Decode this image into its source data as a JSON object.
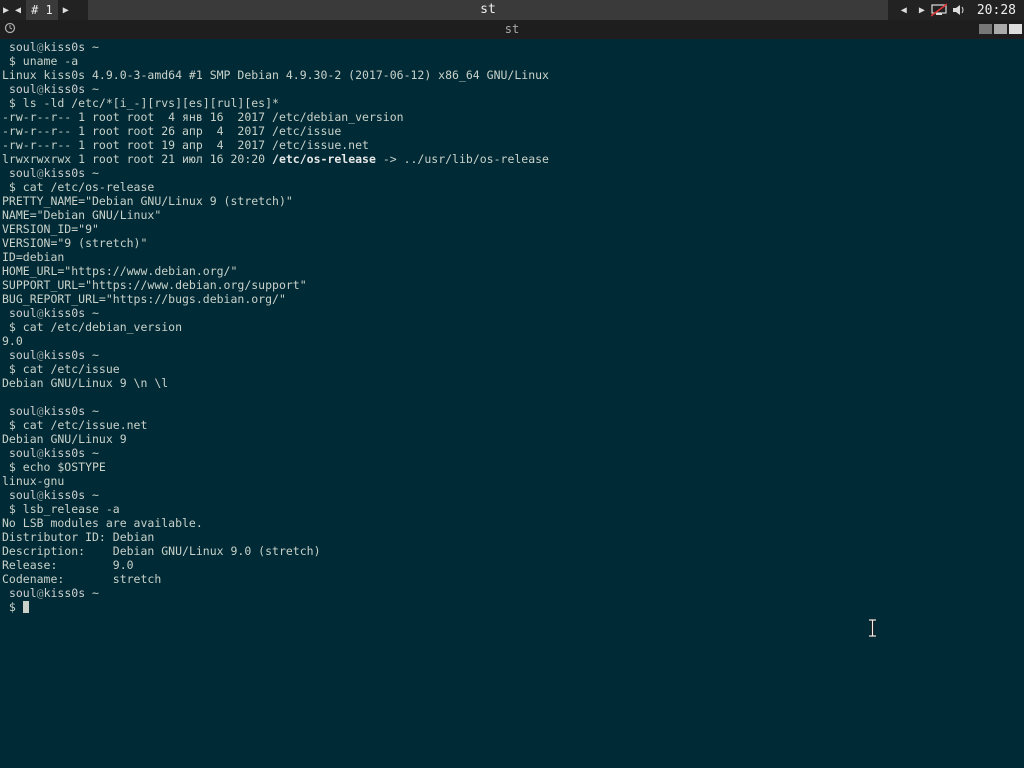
{
  "panel": {
    "workspace_label": "# 1",
    "window_title": "st",
    "clock": "20:28"
  },
  "titlebar": {
    "title": "st"
  },
  "terminal": {
    "lines": [
      {
        "type": "prompt",
        "user": "soul",
        "at": "@",
        "host": "kiss0s",
        "path": " ~"
      },
      {
        "type": "cmd",
        "text": " $ uname -a"
      },
      {
        "type": "out",
        "text": "Linux kiss0s 4.9.0-3-amd64 #1 SMP Debian 4.9.30-2 (2017-06-12) x86_64 GNU/Linux"
      },
      {
        "type": "prompt",
        "user": "soul",
        "at": "@",
        "host": "kiss0s",
        "path": " ~"
      },
      {
        "type": "cmd",
        "text": " $ ls -ld /etc/*[i_-][rvs][es][rul][es]*"
      },
      {
        "type": "out",
        "text": "-rw-r--r-- 1 root root  4 янв 16  2017 /etc/debian_version"
      },
      {
        "type": "out",
        "text": "-rw-r--r-- 1 root root 26 апр  4  2017 /etc/issue"
      },
      {
        "type": "out",
        "text": "-rw-r--r-- 1 root root 19 апр  4  2017 /etc/issue.net"
      },
      {
        "type": "link",
        "pre": "lrwxrwxrwx 1 root root 21 июл 16 20:20 ",
        "bold": "/etc/os-release",
        "post": " -> ../usr/lib/os-release"
      },
      {
        "type": "prompt",
        "user": "soul",
        "at": "@",
        "host": "kiss0s",
        "path": " ~"
      },
      {
        "type": "cmd",
        "text": " $ cat /etc/os-release"
      },
      {
        "type": "out",
        "text": "PRETTY_NAME=\"Debian GNU/Linux 9 (stretch)\""
      },
      {
        "type": "out",
        "text": "NAME=\"Debian GNU/Linux\""
      },
      {
        "type": "out",
        "text": "VERSION_ID=\"9\""
      },
      {
        "type": "out",
        "text": "VERSION=\"9 (stretch)\""
      },
      {
        "type": "out",
        "text": "ID=debian"
      },
      {
        "type": "out",
        "text": "HOME_URL=\"https://www.debian.org/\""
      },
      {
        "type": "out",
        "text": "SUPPORT_URL=\"https://www.debian.org/support\""
      },
      {
        "type": "out",
        "text": "BUG_REPORT_URL=\"https://bugs.debian.org/\""
      },
      {
        "type": "prompt",
        "user": "soul",
        "at": "@",
        "host": "kiss0s",
        "path": " ~"
      },
      {
        "type": "cmd",
        "text": " $ cat /etc/debian_version"
      },
      {
        "type": "out",
        "text": "9.0"
      },
      {
        "type": "prompt",
        "user": "soul",
        "at": "@",
        "host": "kiss0s",
        "path": " ~"
      },
      {
        "type": "cmd",
        "text": " $ cat /etc/issue"
      },
      {
        "type": "out",
        "text": "Debian GNU/Linux 9 \\n \\l"
      },
      {
        "type": "out",
        "text": ""
      },
      {
        "type": "prompt",
        "user": "soul",
        "at": "@",
        "host": "kiss0s",
        "path": " ~"
      },
      {
        "type": "cmd",
        "text": " $ cat /etc/issue.net"
      },
      {
        "type": "out",
        "text": "Debian GNU/Linux 9"
      },
      {
        "type": "prompt",
        "user": "soul",
        "at": "@",
        "host": "kiss0s",
        "path": " ~"
      },
      {
        "type": "cmd",
        "text": " $ echo $OSTYPE"
      },
      {
        "type": "out",
        "text": "linux-gnu"
      },
      {
        "type": "prompt",
        "user": "soul",
        "at": "@",
        "host": "kiss0s",
        "path": " ~"
      },
      {
        "type": "cmd",
        "text": " $ lsb_release -a"
      },
      {
        "type": "out",
        "text": "No LSB modules are available."
      },
      {
        "type": "out",
        "text": "Distributor ID:\tDebian"
      },
      {
        "type": "out",
        "text": "Description:\tDebian GNU/Linux 9.0 (stretch)"
      },
      {
        "type": "out",
        "text": "Release:\t9.0"
      },
      {
        "type": "out",
        "text": "Codename:\tstretch"
      },
      {
        "type": "prompt",
        "user": "soul",
        "at": "@",
        "host": "kiss0s",
        "path": " ~"
      },
      {
        "type": "input",
        "text": " $ "
      }
    ]
  }
}
